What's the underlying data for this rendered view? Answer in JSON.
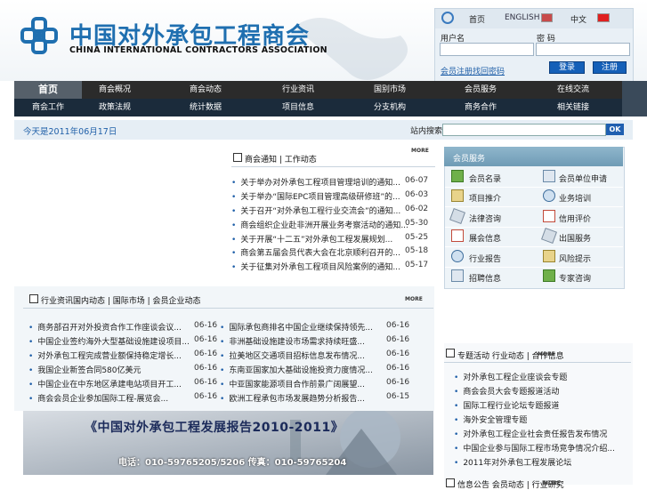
{
  "header": {
    "title_cn": "中国对外承包工程商会",
    "title_en": "CHINA INTERNATIONAL CONTRACTORS ASSOCIATION"
  },
  "login": {
    "home_label": "首页",
    "english_label": "ENGLISH",
    "cn_label": "中文",
    "username_label": "用户名",
    "password_label": "密 码",
    "register_link": "会员注册找回密码",
    "login_button": "登录",
    "register_button": "注册"
  },
  "nav": {
    "row1": [
      "首页",
      "商会概况",
      "商会动态",
      "行业资讯",
      "国别市场",
      "会员服务",
      "在线交流"
    ],
    "row2": [
      "商会工作",
      "政策法规",
      "统计数据",
      "项目信息",
      "分支机构",
      "商务合作",
      "相关链接"
    ]
  },
  "datebar": {
    "date": "今天是2011年06月17日",
    "search_label": "站内搜索",
    "ok_label": "OK"
  },
  "latest": {
    "title": "商会通知 | 工作动态",
    "more": "MORE",
    "items": [
      {
        "text": "关于举办对外承包工程项目管理培训的通知...",
        "date": "06-07"
      },
      {
        "text": "关于举办“国际EPC项目管理高级研修班”的...",
        "date": "06-03"
      },
      {
        "text": "关于召开“对外承包工程行业交流会”的通知...",
        "date": "06-02"
      },
      {
        "text": "商会组织企业赴非洲开展业务考察活动的通知...",
        "date": "05-30"
      },
      {
        "text": "关于开展“十二五”对外承包工程发展规划...",
        "date": "05-25"
      },
      {
        "text": "商会第五届会员代表大会在北京顺利召开的...",
        "date": "05-18"
      },
      {
        "text": "关于征集对外承包工程项目风险案例的通知...",
        "date": "05-17"
      }
    ]
  },
  "mid": {
    "title": "行业资讯国内动态 | 国际市场 | 会员企业动态",
    "more": "MORE",
    "col1": [
      {
        "text": "商务部召开对外投资合作工作座谈会议...",
        "date": "06-16"
      },
      {
        "text": "中国企业签约海外大型基础设施建设项目...",
        "date": "06-16"
      },
      {
        "text": "对外承包工程完成营业额保持稳定增长...",
        "date": "06-16"
      },
      {
        "text": "我国企业新签合同580亿美元",
        "date": "06-16"
      },
      {
        "text": "中国企业在中东地区承建电站项目开工...",
        "date": "06-16"
      },
      {
        "text": "商会会员企业参加国际工程-展览会...",
        "date": "06-16"
      }
    ],
    "col2": [
      {
        "text": "国际承包商排名中国企业继续保持领先...",
        "date": "06-16"
      },
      {
        "text": "非洲基础设施建设市场需求持续旺盛...",
        "date": "06-16"
      },
      {
        "text": "拉美地区交通项目招标信息发布情况...",
        "date": "06-16"
      },
      {
        "text": "东南亚国家加大基础设施投资力度情况...",
        "date": "06-16"
      },
      {
        "text": "中亚国家能源项目合作前景广阔展望...",
        "date": "06-16"
      },
      {
        "text": "欧洲工程承包市场发展趋势分析报告...",
        "date": "06-15"
      }
    ]
  },
  "services": {
    "title": "会员服务",
    "items": [
      "会员名录",
      "会员单位申请",
      "项目推介",
      "业务培训",
      "法律咨询",
      "信用评价",
      "展会信息",
      "出国服务",
      "行业报告",
      "风险提示",
      "招聘信息",
      "专家咨询"
    ]
  },
  "banner": {
    "title": "《中国对外承包工程发展报告2010-2011》",
    "contact": "电话：010-59765205/5206 传真：010-59765204"
  },
  "right_lower": {
    "title": "专题活动 行业动态 | 合作信息",
    "more": "MORE",
    "items": [
      "对外承包工程企业座谈会专题",
      "商会会员大会专题报道活动",
      "国际工程行业论坛专题报道",
      "海外安全管理专题",
      "对外承包工程企业社会责任报告发布情况",
      "中国企业参与国际工程市场竞争情况介绍...",
      "2011年对外承包工程发展论坛"
    ]
  },
  "footer_partial": {
    "title": "信息公告 会员动态 | 行业研究",
    "more": "MORE"
  },
  "colors": {
    "brand_blue": "#1f6fb0",
    "nav_dark": "#2b2b2b",
    "link_blue": "#1f5fa8"
  }
}
